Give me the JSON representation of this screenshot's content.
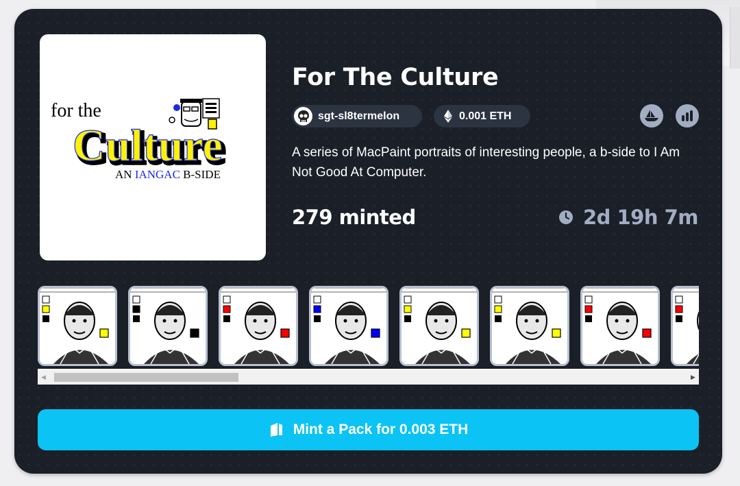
{
  "collection": {
    "title": "For The Culture",
    "description": "A series of MacPaint portraits of interesting people, a b-side to I Am Not Good At Computer.",
    "creator": {
      "name": "sgt-sl8termelon",
      "avatar_icon": "skull-avatar"
    },
    "price": {
      "label": "0.001 ETH",
      "icon": "ethereum-icon"
    },
    "links": [
      {
        "name": "opensea-link",
        "icon": "boat-icon"
      },
      {
        "name": "stats-link",
        "icon": "chart-icon"
      }
    ],
    "minted_label": "279 minted",
    "time_remaining": "2d 19h 7m"
  },
  "cover": {
    "line1": "for the",
    "line2": "Culture",
    "line3_a": "AN ",
    "line3_b": "IANGAC",
    "line3_c": " B-SIDE"
  },
  "gallery": {
    "thumbnails": [
      {
        "name": "portrait-1",
        "accent": "#ffff00"
      },
      {
        "name": "portrait-2",
        "accent": "#000000"
      },
      {
        "name": "portrait-3",
        "accent": "#ff0000"
      },
      {
        "name": "portrait-4",
        "accent": "#0000ff"
      },
      {
        "name": "portrait-5",
        "accent": "#ffff00"
      },
      {
        "name": "portrait-6",
        "accent": "#ffff00"
      },
      {
        "name": "portrait-7",
        "accent": "#ff0000"
      },
      {
        "name": "portrait-8",
        "accent": "#ff0000"
      }
    ],
    "scroll_position": 0.03
  },
  "mint_button": {
    "label": "Mint a Pack for 0.003 ETH",
    "icon": "pack-icon"
  },
  "colors": {
    "card_bg": "#1a1f28",
    "pill_bg": "#2c3341",
    "muted": "#a3adc2",
    "accent": "#0bc3f5"
  }
}
